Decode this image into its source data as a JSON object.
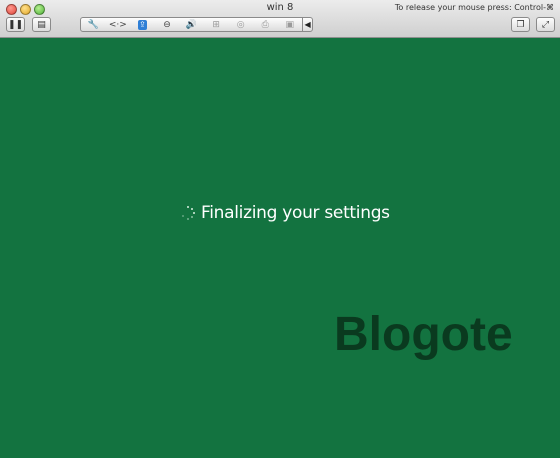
{
  "window": {
    "title": "win 8",
    "release_hint": "To release your mouse press: Control-⌘"
  },
  "toolbar": {
    "left_buttons": [
      {
        "name": "pause-button",
        "icon": "pause-icon",
        "glyph": "❚❚"
      },
      {
        "name": "snapshot-button",
        "icon": "snapshot-icon",
        "glyph": "▤"
      }
    ],
    "segments": [
      {
        "name": "settings-segment",
        "icon": "wrench-icon",
        "glyph": "🔧",
        "state": "normal"
      },
      {
        "name": "network-segment",
        "icon": "network-icon",
        "glyph": "<·>",
        "state": "normal"
      },
      {
        "name": "shared-folders-segment",
        "icon": "shared-folders-icon",
        "glyph": "⇪",
        "state": "active"
      },
      {
        "name": "hard-disk-segment",
        "icon": "hard-disk-icon",
        "glyph": "⊖",
        "state": "normal"
      },
      {
        "name": "sound-segment",
        "icon": "speaker-icon",
        "glyph": "🔊",
        "state": "normal"
      },
      {
        "name": "usb-segment",
        "icon": "usb-icon",
        "glyph": "⊞",
        "state": "dim"
      },
      {
        "name": "camera-segment",
        "icon": "camera-icon",
        "glyph": "◎",
        "state": "dim"
      },
      {
        "name": "printer-segment",
        "icon": "printer-icon",
        "glyph": "⎙",
        "state": "dim"
      },
      {
        "name": "display-segment",
        "icon": "display-icon",
        "glyph": "▣",
        "state": "dim"
      }
    ],
    "collapse_arrow": "◀",
    "right_buttons": [
      {
        "name": "unity-view-button",
        "icon": "windows-stack-icon",
        "glyph": "❐"
      },
      {
        "name": "fullscreen-button",
        "icon": "expand-icon",
        "glyph": "⤢"
      }
    ]
  },
  "guest": {
    "status_text": "Finalizing your settings",
    "watermark_text": "Blogote",
    "background_color": "#137340"
  }
}
